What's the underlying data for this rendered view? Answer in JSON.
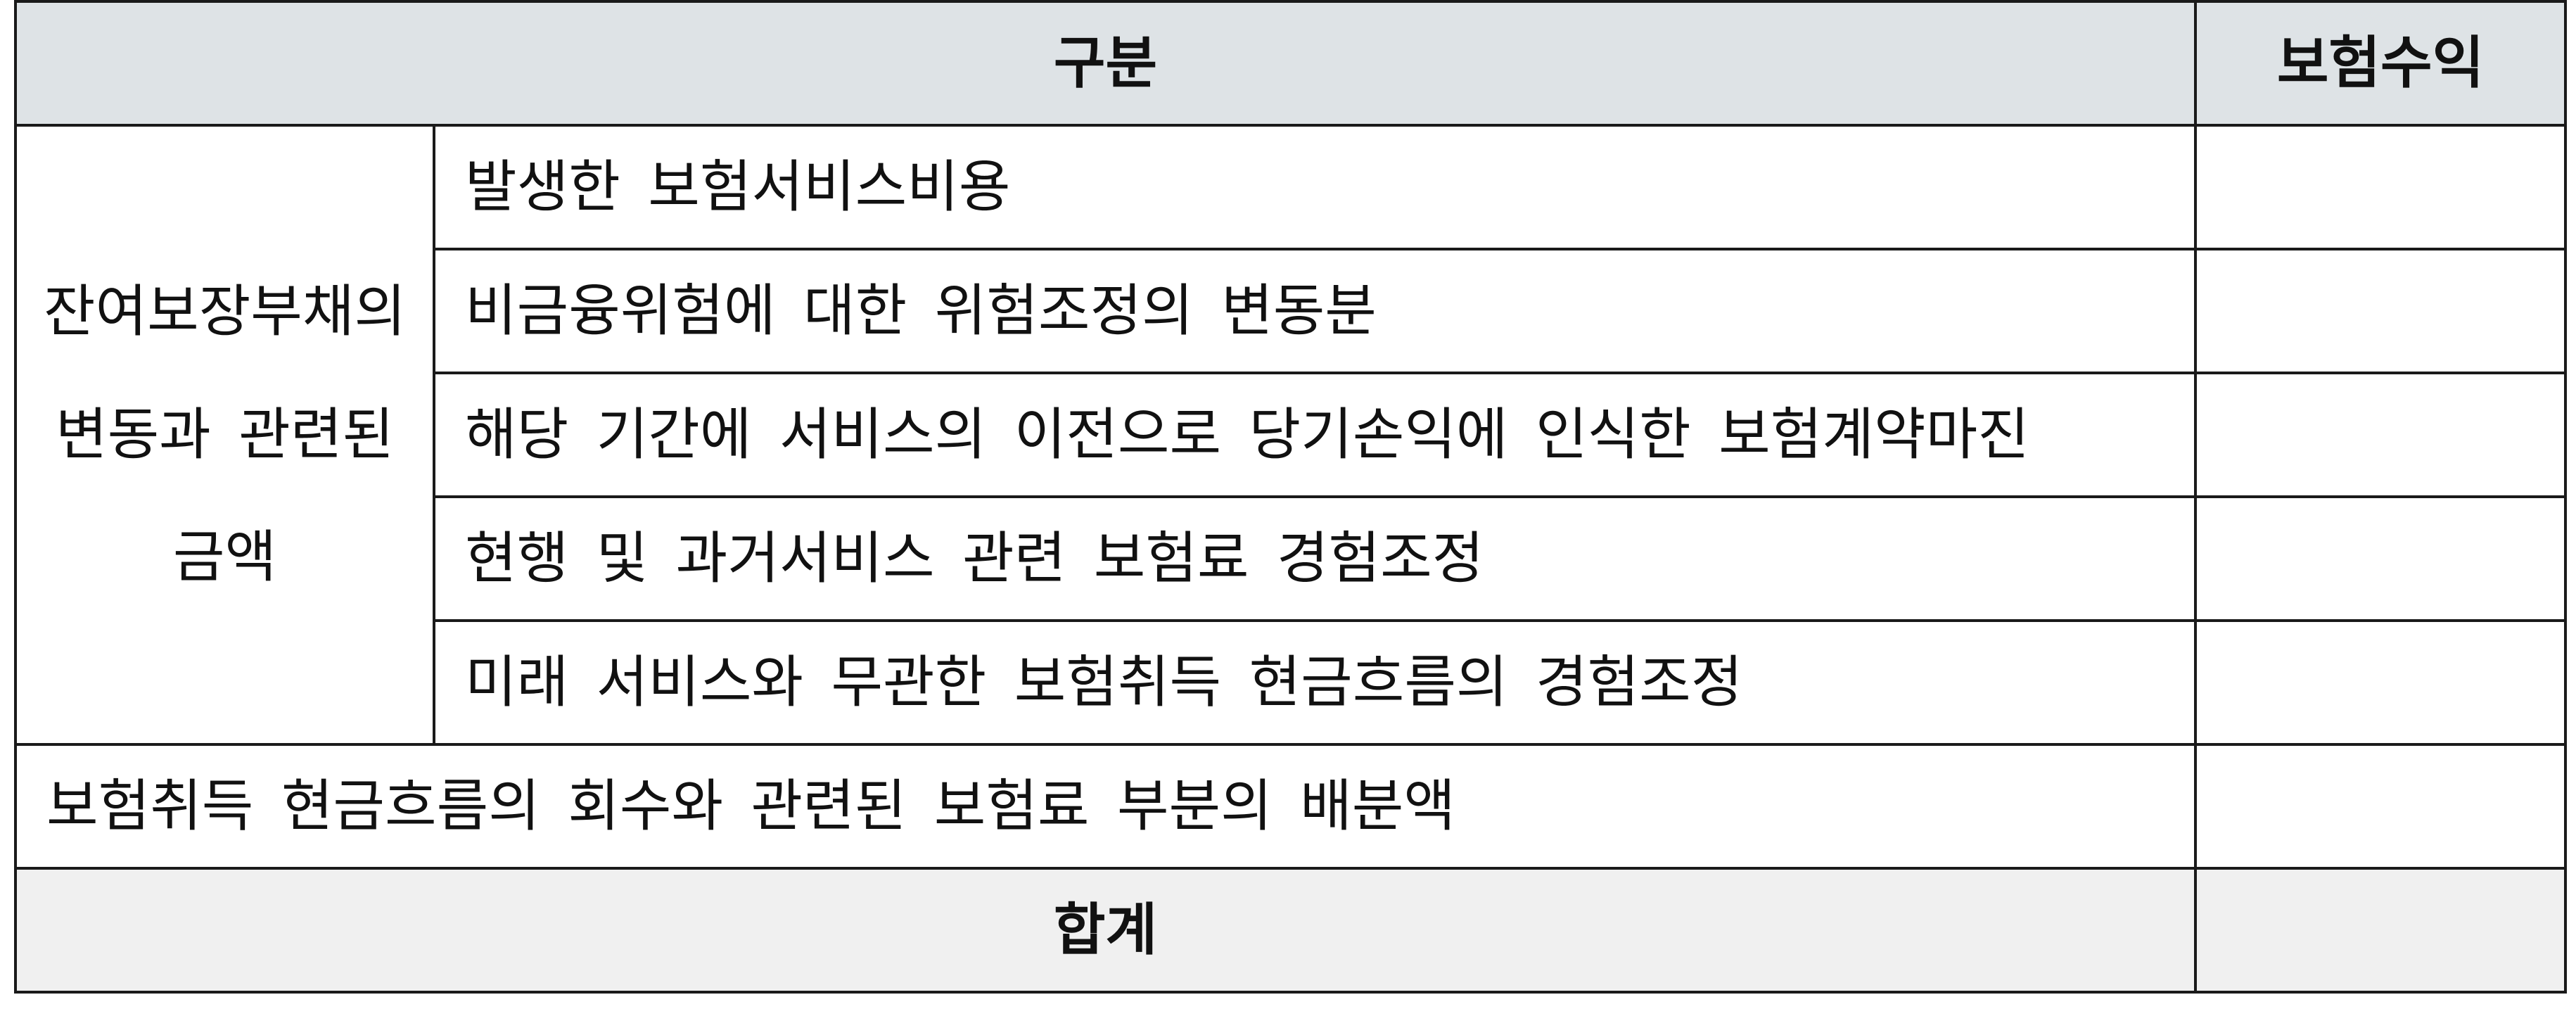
{
  "table": {
    "header": {
      "category": "구분",
      "revenue": "보험수익"
    },
    "group": {
      "label_lines": [
        "잔여보장부채의",
        "변동과 관련된",
        "금액"
      ],
      "items": [
        "발생한 보험서비스비용",
        "비금융위험에 대한 위험조정의 변동분",
        "해당 기간에 서비스의 이전으로 당기손익에 인식한 보험계약마진",
        "현행 및 과거서비스 관련 보험료 경험조정",
        "미래 서비스와 무관한 보험취득 현금흐름의 경험조정"
      ]
    },
    "allocation_row": "보험취득 현금흐름의 회수와 관련된 보험료 부분의 배분액",
    "total_label": "합계"
  }
}
